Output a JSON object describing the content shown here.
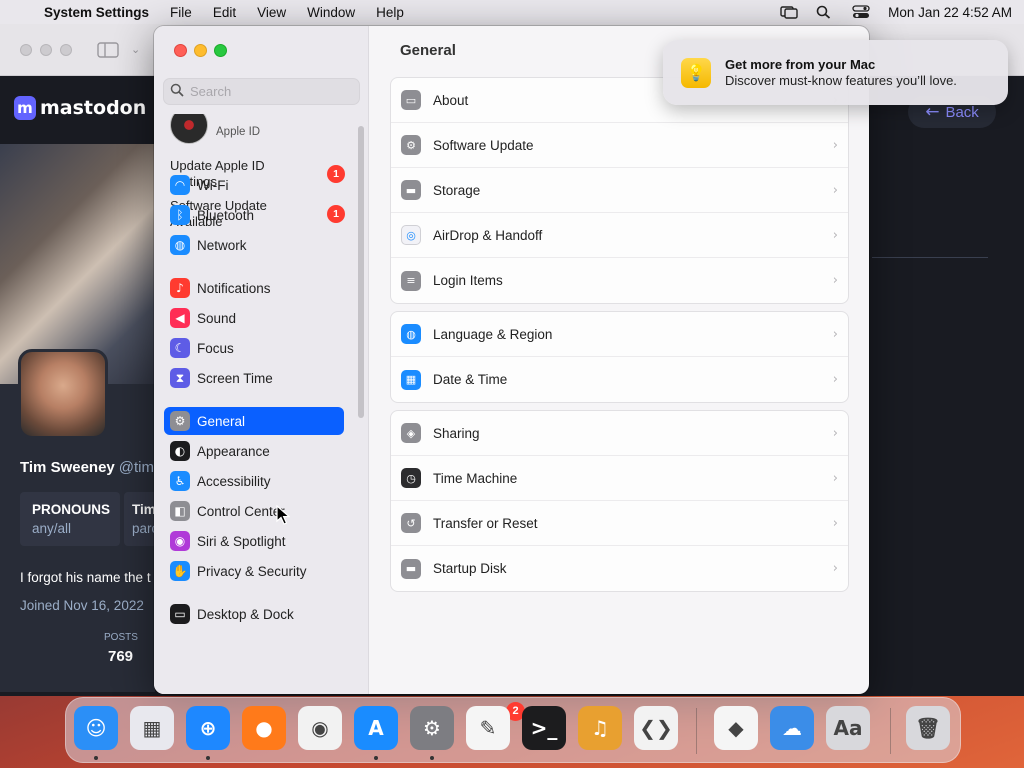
{
  "menubar": {
    "app_name": "System Settings",
    "menus": [
      "File",
      "Edit",
      "View",
      "Window",
      "Help"
    ],
    "clock": "Mon Jan 22  4:52 AM"
  },
  "browser": {
    "brand": "mastodon",
    "profile": {
      "display_name": "Tim Sweeney",
      "handle": "@tim",
      "pronouns_label": "PRONOUNS",
      "pronouns_value": "any/all",
      "field2_label": "Tim",
      "field2_value": "parc",
      "bio": "I forgot his name the t",
      "joined": "Joined Nov 16, 2022",
      "posts_label": "POSTS",
      "posts_count": "769"
    },
    "back_label": "Back"
  },
  "settings": {
    "search_placeholder": "Search",
    "apple_id_label": "Apple ID",
    "updates": [
      {
        "label": "Update Apple ID Settings",
        "badge": "1"
      },
      {
        "label": "Software Update Available",
        "badge": "1"
      }
    ],
    "sidebar": [
      {
        "label": "Wi-Fi",
        "icon": "wifi-icon",
        "color": "#1a8cff"
      },
      {
        "label": "Bluetooth",
        "icon": "bluetooth-icon",
        "color": "#1a8cff"
      },
      {
        "label": "Network",
        "icon": "globe-icon",
        "color": "#1a8cff"
      },
      {
        "label": "Notifications",
        "icon": "bell-icon",
        "color": "#ff3b30"
      },
      {
        "label": "Sound",
        "icon": "speaker-icon",
        "color": "#ff2d55"
      },
      {
        "label": "Focus",
        "icon": "moon-icon",
        "color": "#5e5ce6"
      },
      {
        "label": "Screen Time",
        "icon": "hourglass-icon",
        "color": "#5e5ce6"
      },
      {
        "label": "General",
        "icon": "gear-icon",
        "color": "#8e8e93"
      },
      {
        "label": "Appearance",
        "icon": "appearance-icon",
        "color": "#1c1c1e"
      },
      {
        "label": "Accessibility",
        "icon": "accessibility-icon",
        "color": "#1a8cff"
      },
      {
        "label": "Control Center",
        "icon": "control-center-icon",
        "color": "#8e8e93"
      },
      {
        "label": "Siri & Spotlight",
        "icon": "siri-icon",
        "color": "#b03ad8"
      },
      {
        "label": "Privacy & Security",
        "icon": "hand-icon",
        "color": "#1a8cff"
      },
      {
        "label": "Desktop & Dock",
        "icon": "dock-icon",
        "color": "#1c1c1e"
      }
    ],
    "selected": "General",
    "content_title": "General",
    "groups": [
      [
        {
          "label": "About",
          "icon": "about-icon",
          "color": "#8e8e93"
        },
        {
          "label": "Software Update",
          "icon": "gear-icon",
          "color": "#8e8e93"
        },
        {
          "label": "Storage",
          "icon": "storage-icon",
          "color": "#8e8e93"
        },
        {
          "label": "AirDrop & Handoff",
          "icon": "airdrop-icon",
          "color": "#f2f2f7"
        },
        {
          "label": "Login Items",
          "icon": "list-icon",
          "color": "#8e8e93"
        }
      ],
      [
        {
          "label": "Language & Region",
          "icon": "globe-icon",
          "color": "#1a8cff"
        },
        {
          "label": "Date & Time",
          "icon": "calendar-icon",
          "color": "#1a8cff"
        }
      ],
      [
        {
          "label": "Sharing",
          "icon": "sharing-icon",
          "color": "#8e8e93"
        },
        {
          "label": "Time Machine",
          "icon": "time-machine-icon",
          "color": "#2c2c2e"
        },
        {
          "label": "Transfer or Reset",
          "icon": "reset-icon",
          "color": "#8e8e93"
        },
        {
          "label": "Startup Disk",
          "icon": "disk-icon",
          "color": "#8e8e93"
        }
      ]
    ]
  },
  "notification": {
    "title": "Get more from your Mac",
    "body": "Discover must-know features you’ll love."
  },
  "dock": {
    "apps": [
      {
        "name": "finder-icon",
        "color": "#2b8ff7",
        "glyph": "☺",
        "running": true
      },
      {
        "name": "launchpad-icon",
        "color": "#e8e8ee",
        "glyph": "▦",
        "running": false
      },
      {
        "name": "safari-icon",
        "color": "#1e88ff",
        "glyph": "⊕",
        "running": true
      },
      {
        "name": "firefox-icon",
        "color": "#ff7a1a",
        "glyph": "●",
        "running": false
      },
      {
        "name": "chrome-icon",
        "color": "#f2f2f2",
        "glyph": "◉",
        "running": false
      },
      {
        "name": "app-store-icon",
        "color": "#1a8cff",
        "glyph": "A",
        "running": true
      },
      {
        "name": "system-settings-icon",
        "color": "#7d7d82",
        "glyph": "⚙",
        "running": true
      },
      {
        "name": "textedit-icon",
        "color": "#f5f5f5",
        "glyph": "✎",
        "running": false
      },
      {
        "name": "terminal-icon",
        "color": "#1c1c1e",
        "glyph": ">_",
        "running": false
      },
      {
        "name": "garageband-icon",
        "color": "#e8a030",
        "glyph": "♫",
        "running": false
      },
      {
        "name": "vscode-icon",
        "color": "#f2f2f2",
        "glyph": "❮❯",
        "running": false
      },
      {
        "name": "visual-studio-icon",
        "color": "#f5f5f5",
        "glyph": "◆",
        "running": false
      },
      {
        "name": "weather-icon",
        "color": "#3b8de8",
        "glyph": "☁",
        "running": false
      },
      {
        "name": "font-book-icon",
        "color": "#d8d8dc",
        "glyph": "Aa",
        "running": false
      },
      {
        "name": "trash-icon",
        "color": "#d8d8dc",
        "glyph": "🗑",
        "running": false
      }
    ],
    "settings_badge": "2"
  }
}
